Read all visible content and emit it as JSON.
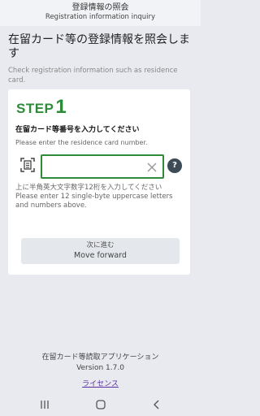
{
  "header": {
    "title": "登録情報の照会",
    "subtitle": "Registration information inquiry"
  },
  "page": {
    "title": "在留カード等の登録情報を照会します",
    "description": "Check registration information such as residence card."
  },
  "step": {
    "word": "STEP",
    "number": "1"
  },
  "instruction": {
    "jp": "在留カード等番号を入力してください",
    "en": "Please enter the residence card number."
  },
  "input": {
    "value": "",
    "placeholder": ""
  },
  "icons": {
    "scan": "card-scan-icon",
    "clear": "close-icon",
    "help": "help-icon"
  },
  "help_glyph": "?",
  "hint": {
    "jp": "上に半角英大文字数字12桁を入力してください",
    "en": "Please enter 12 single-byte uppercase letters and numbers above."
  },
  "next_button": {
    "jp": "次に進む",
    "en": "Move forward"
  },
  "footer": {
    "app_name": "在留カード等読取アプリケーション",
    "version": "Version 1.7.0",
    "license_link": "ライセンス"
  },
  "colors": {
    "accent": "#2e8b3a",
    "background": "#e8eaf0",
    "help_button": "#3d4b56",
    "link": "#5a2ea0"
  }
}
